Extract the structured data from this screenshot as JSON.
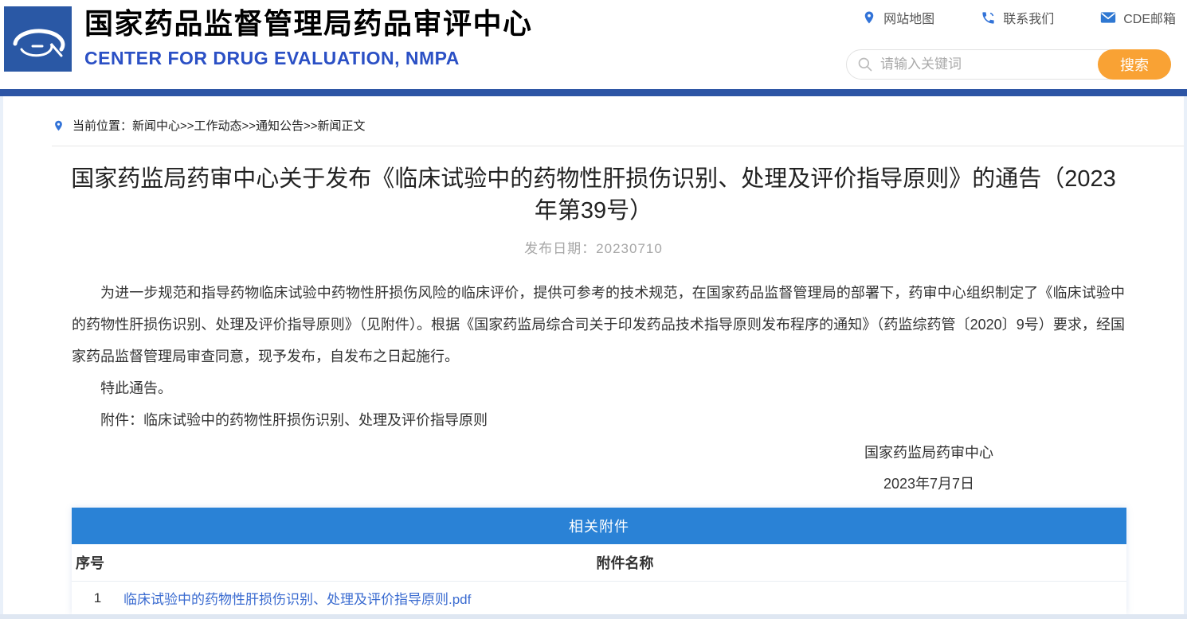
{
  "header": {
    "site_name_cn": "国家药品监督管理局药品审评中心",
    "site_name_en": "CENTER FOR DRUG EVALUATION, NMPA",
    "links": [
      {
        "icon": "map-pin-icon",
        "label": "网站地图"
      },
      {
        "icon": "phone-icon",
        "label": "联系我们"
      },
      {
        "icon": "mail-icon",
        "label": "CDE邮箱"
      }
    ],
    "search": {
      "placeholder": "请输入关键词",
      "button_label": "搜索"
    }
  },
  "breadcrumb": {
    "text": "当前位置：新闻中心>>工作动态>>通知公告>>新闻正文"
  },
  "article": {
    "title": "国家药监局药审中心关于发布《临床试验中的药物性肝损伤识别、处理及评价指导原则》的通告（2023年第39号）",
    "publish_date_line": "发布日期：20230710",
    "body": [
      "为进一步规范和指导药物临床试验中药物性肝损伤风险的临床评价，提供可参考的技术规范，在国家药品监督管理局的部署下，药审中心组织制定了《临床试验中的药物性肝损伤识别、处理及评价指导原则》（见附件）。根据《国家药监局综合司关于印发药品技术指导原则发布程序的通知》（药监综药管〔2020〕9号）要求，经国家药品监督管理局审查同意，现予发布，自发布之日起施行。",
      "特此通告。",
      "附件：临床试验中的药物性肝损伤识别、处理及评价指导原则"
    ],
    "signature": "国家药监局药审中心",
    "sign_date": "2023年7月7日"
  },
  "attachments": {
    "section_title": "相关附件",
    "columns": {
      "no": "序号",
      "name": "附件名称"
    },
    "rows": [
      {
        "no": "1",
        "name": "临床试验中的药物性肝损伤识别、处理及评价指导原则.pdf"
      }
    ]
  },
  "colors": {
    "navbar_blue": "#2d55a5",
    "table_header_blue": "#2a82d6",
    "search_button_orange": "#f9a234",
    "link_blue": "#3a6bd0",
    "subtitle_blue": "#2b50c5",
    "icon_blue": "#3273d8",
    "logo_blue": "#2a58a5"
  }
}
